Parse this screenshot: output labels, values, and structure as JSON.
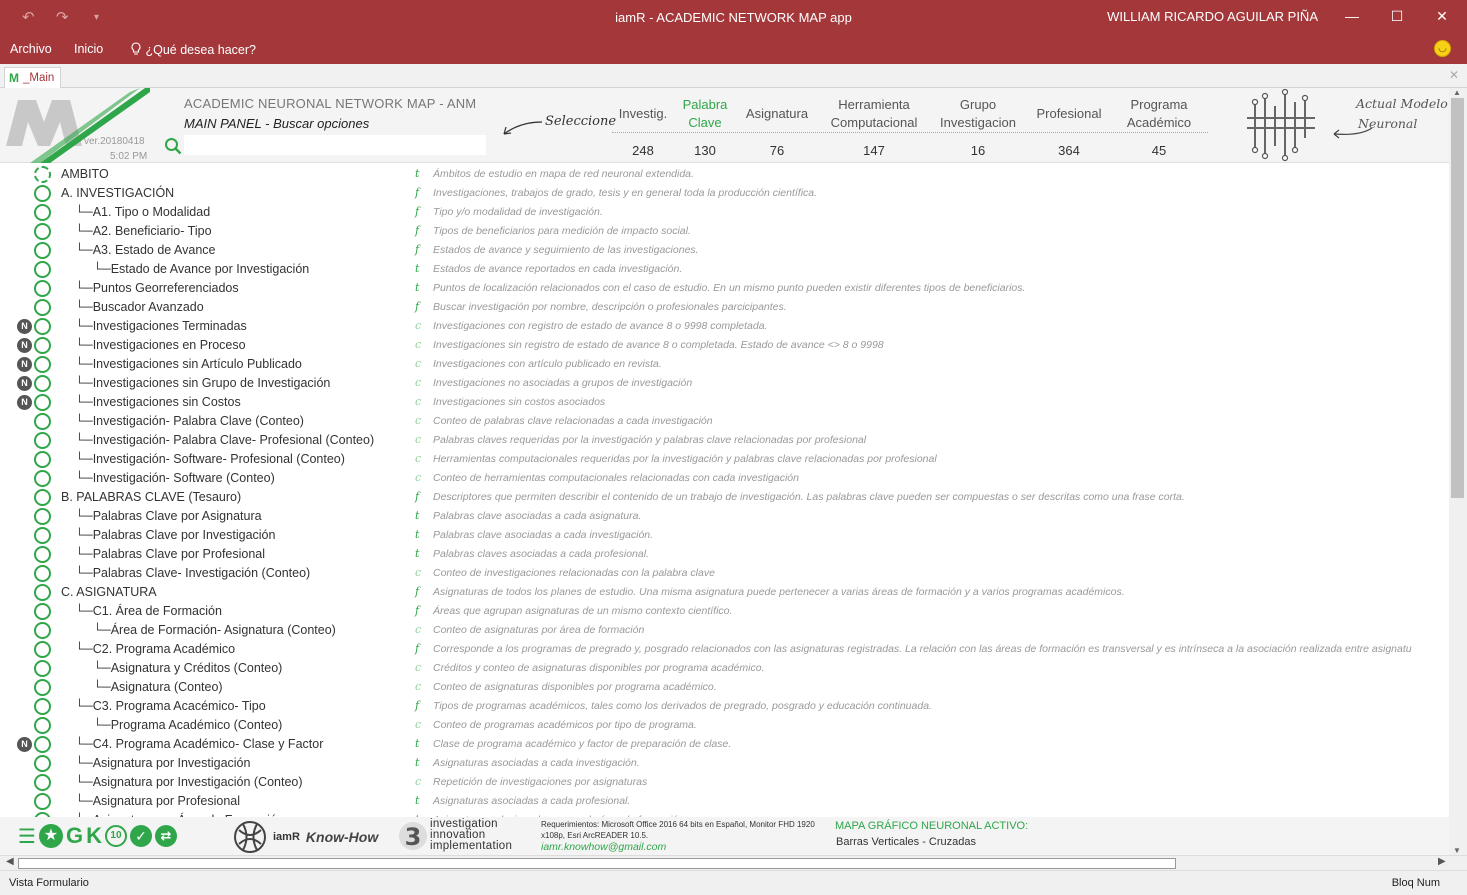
{
  "window": {
    "title": "iamR - ACADEMIC NETWORK MAP app",
    "user": "WILLIAM RICARDO AGUILAR PIÑA"
  },
  "ribbon": {
    "archivo": "Archivo",
    "inicio": "Inicio",
    "tell_me": "¿Qué desea hacer?"
  },
  "doc_tab": {
    "label": "_Main"
  },
  "header": {
    "title": "ACADEMIC NEURONAL NETWORK MAP - ANM",
    "subtitle": "MAIN PANEL - Buscar opciones",
    "version": "ver.20180418",
    "time": "5:02 PM",
    "search_value": "",
    "selecione": "Seleccione",
    "actual_1": "Actual Modelo",
    "actual_2": "Neuronal",
    "accent": "#2fa64a",
    "brand": "#a4373a"
  },
  "stats": [
    {
      "l1": "Investig.",
      "l2": "",
      "value": "248",
      "green": false
    },
    {
      "l1": "Palabra",
      "l2": "Clave",
      "value": "130",
      "green": true
    },
    {
      "l1": "Asignatura",
      "l2": "",
      "value": "76",
      "green": false
    },
    {
      "l1": "Herramienta",
      "l2": "Computacional",
      "value": "147",
      "green": false
    },
    {
      "l1": "Grupo",
      "l2": "Investigacion",
      "value": "16",
      "green": false
    },
    {
      "l1": "Profesional",
      "l2": "",
      "value": "364",
      "green": false
    },
    {
      "l1": "Programa",
      "l2": "Académico",
      "value": "45",
      "green": false
    }
  ],
  "rows": [
    {
      "label": "AMBITO",
      "level": 0,
      "n": false,
      "f": "t",
      "desc": "Ámbitos de estudio en mapa de red neuronal extendida."
    },
    {
      "label": "A. INVESTIGACIÓN",
      "level": 0,
      "n": false,
      "f": "f",
      "desc": "Investigaciones, trabajos de grado, tesis y en general toda la producción científica."
    },
    {
      "label": "└─A1. Tipo o Modalidad",
      "level": 1,
      "n": false,
      "f": "f",
      "desc": "Tipo y/o modalidad de investigación."
    },
    {
      "label": "└─A2. Beneficiario- Tipo",
      "level": 1,
      "n": false,
      "f": "f",
      "desc": "Tipos de beneficiarios para medición de impacto social."
    },
    {
      "label": "└─A3. Estado de Avance",
      "level": 1,
      "n": false,
      "f": "f",
      "desc": "Estados de avance y seguimiento de las investigaciones."
    },
    {
      "label": "└─Estado de Avance por Investigación",
      "level": 2,
      "n": false,
      "f": "t",
      "desc": "Estados de avance reportados en cada investigación."
    },
    {
      "label": "└─Puntos Georreferenciados",
      "level": 1,
      "n": false,
      "f": "t",
      "desc": "Puntos de localización relacionados con el caso de estudio. En un mismo punto pueden existir diferentes tipos de beneficiarios."
    },
    {
      "label": "└─Buscador Avanzado",
      "level": 1,
      "n": false,
      "f": "f",
      "desc": "Buscar investigación por nombre, descripción o profesionales parcicipantes."
    },
    {
      "label": "└─Investigaciones Terminadas",
      "level": 1,
      "n": true,
      "f": "c",
      "desc": "Investigaciones con registro de estado de avance 8 o 9998 completada."
    },
    {
      "label": "└─Investigaciones en Proceso",
      "level": 1,
      "n": true,
      "f": "c",
      "desc": "Investigaciones sin registro de estado de avance 8 o completada. Estado de avance <> 8 o 9998"
    },
    {
      "label": "└─Investigaciones sin Artículo Publicado",
      "level": 1,
      "n": true,
      "f": "c",
      "desc": "Investigaciones con artículo publicado en revista."
    },
    {
      "label": "└─Investigaciones sin Grupo de Investigación",
      "level": 1,
      "n": true,
      "f": "c",
      "desc": "Investigaciones no asociadas a grupos de investigación"
    },
    {
      "label": "└─Investigaciones sin Costos",
      "level": 1,
      "n": true,
      "f": "c",
      "desc": "Investigaciones sin costos asociados"
    },
    {
      "label": "└─Investigación- Palabra Clave (Conteo)",
      "level": 1,
      "n": false,
      "f": "c",
      "desc": "Conteo de palabras clave relacionadas a cada investigación"
    },
    {
      "label": "└─Investigación- Palabra Clave- Profesional (Conteo)",
      "level": 1,
      "n": false,
      "f": "c",
      "desc": "Palabras claves requeridas por la investigación y palabras clave relacionadas por profesional"
    },
    {
      "label": "└─Investigación- Software- Profesional (Conteo)",
      "level": 1,
      "n": false,
      "f": "c",
      "desc": "Herramientas computacionales requeridas por la investigación y palabras clave relacionadas por profesional"
    },
    {
      "label": "└─Investigación- Software (Conteo)",
      "level": 1,
      "n": false,
      "f": "c",
      "desc": "Conteo de herramientas computacionales relacionadas con cada investigación"
    },
    {
      "label": "B. PALABRAS CLAVE (Tesauro)",
      "level": 0,
      "n": false,
      "f": "f",
      "desc": "Descriptores que permiten describir el contenido de un trabajo de investigación. Las palabras clave pueden ser compuestas o ser descritas como una frase corta."
    },
    {
      "label": "└─Palabras Clave por Asignatura",
      "level": 1,
      "n": false,
      "f": "t",
      "desc": "Palabras clave asociadas a cada asignatura."
    },
    {
      "label": "└─Palabras Clave por Investigación",
      "level": 1,
      "n": false,
      "f": "t",
      "desc": "Palabras clave asociadas a cada investigación."
    },
    {
      "label": "└─Palabras Clave por Profesional",
      "level": 1,
      "n": false,
      "f": "t",
      "desc": "Palabras claves asociadas a cada profesional."
    },
    {
      "label": "└─Palabras Clave- Investigación (Conteo)",
      "level": 1,
      "n": false,
      "f": "c",
      "desc": "Conteo de investigaciones relacionadas con la palabra clave"
    },
    {
      "label": "C. ASIGNATURA",
      "level": 0,
      "n": false,
      "f": "f",
      "desc": "Asignaturas de todos los planes de estudio. Una misma asignatura puede pertenecer a varias áreas de formación y a varios programas académicos."
    },
    {
      "label": "└─C1. Área de Formación",
      "level": 1,
      "n": false,
      "f": "f",
      "desc": "Áreas que agrupan asignaturas de un mismo contexto científico."
    },
    {
      "label": "└─Área de Formación- Asignatura (Conteo)",
      "level": 2,
      "n": false,
      "f": "c",
      "desc": "Conteo de asignaturas por área de formación"
    },
    {
      "label": "└─C2. Programa Académico",
      "level": 1,
      "n": false,
      "f": "f",
      "desc": "Corresponde a los programas de pregrado y, posgrado relacionados con las asignaturas registradas. La relación con las áreas de formación es transversal y es intrínseca a la asociación realizada entre asignatu"
    },
    {
      "label": "└─Asignatura y Créditos (Conteo)",
      "level": 2,
      "n": false,
      "f": "c",
      "desc": "Créditos y conteo de asignaturas disponibles por programa académico."
    },
    {
      "label": "└─Asignatura (Conteo)",
      "level": 2,
      "n": false,
      "f": "c",
      "desc": "Conteo de asignaturas disponibles por programa académico."
    },
    {
      "label": "└─C3. Programa Acacémico- Tipo",
      "level": 1,
      "n": false,
      "f": "f",
      "desc": "Tipos de programas académicos, tales como los derivados de pregrado, posgrado y educación continuada."
    },
    {
      "label": "└─Programa Académico (Conteo)",
      "level": 2,
      "n": false,
      "f": "c",
      "desc": "Conteo de programas académicos por tipo de programa."
    },
    {
      "label": "└─C4. Programa Académico- Clase y Factor",
      "level": 1,
      "n": true,
      "f": "t",
      "desc": "Clase de programa académico y factor de preparación de clase."
    },
    {
      "label": "└─Asignatura por Investigación",
      "level": 1,
      "n": false,
      "f": "t",
      "desc": "Asignaturas asociadas a cada investigación."
    },
    {
      "label": "└─Asignatura por Investigación (Conteo)",
      "level": 1,
      "n": false,
      "f": "c",
      "desc": "Repetición de investigaciones por asignaturas"
    },
    {
      "label": "└─Asignatura por Profesional",
      "level": 1,
      "n": false,
      "f": "t",
      "desc": "Asignaturas asociadas a cada profesional."
    },
    {
      "label": "└─Asignatura por Área de Formación",
      "level": 1,
      "n": false,
      "f": "t",
      "desc": "Asignaturas relacionadas con cada área de formación"
    }
  ],
  "footer": {
    "iamr_small": "iamR",
    "know_how": "Know-How",
    "three_1": "investigation",
    "three_2": "innovation",
    "three_3": "implementation",
    "requirements": "Requerimientos: Microsoft Office 2016 64 bits en Español, Monitor FHD 1920 x108p, Esri ArcREADER 10.5.",
    "email": "iamr.knowhow@gmail.com",
    "mapa_label": "MAPA GRÁFICO NEURONAL ACTIVO:",
    "mapa_value": "Barras Verticales - Cruzadas",
    "icons": [
      "list-icon",
      "star-badge-icon",
      "g-icon",
      "k-icon",
      "ten-icon",
      "check-icon",
      "shuffle-icon"
    ]
  },
  "status": {
    "left": "Vista Formulario",
    "right": "Bloq Num"
  }
}
